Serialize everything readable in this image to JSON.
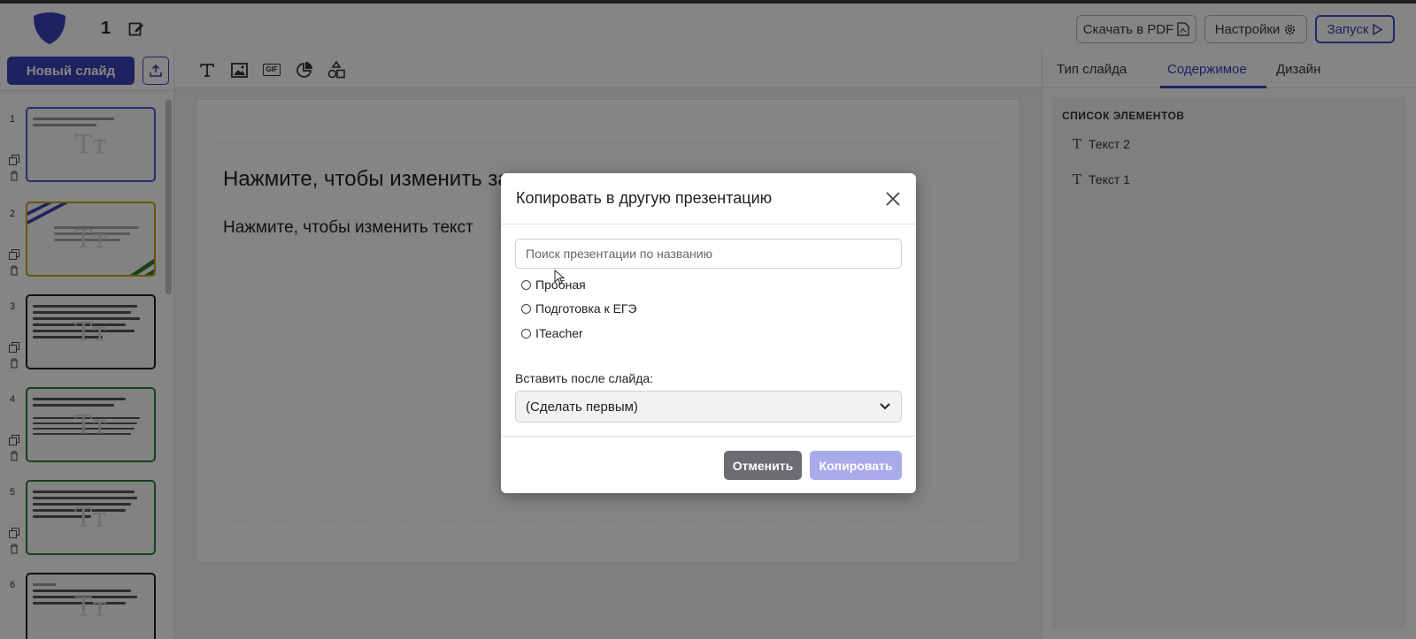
{
  "header": {
    "presentation_name": "1",
    "download_pdf_label": "Скачать в PDF",
    "settings_label": "Настройки",
    "start_label": "Запуск"
  },
  "sidebar": {
    "new_slide_label": "Новый слайд",
    "slides": [
      {
        "number": "1"
      },
      {
        "number": "2"
      },
      {
        "number": "3"
      },
      {
        "number": "4"
      },
      {
        "number": "5"
      },
      {
        "number": "6"
      }
    ]
  },
  "toolbar": {
    "gif_label": "GIF"
  },
  "slide": {
    "title": "Нажмите, чтобы изменить заголовок",
    "text": "Нажмите, чтобы изменить текст"
  },
  "right_panel": {
    "tabs": [
      "Тип слайда",
      "Содержимое",
      "Дизайн"
    ],
    "active_tab": "Содержимое",
    "elements_title": "СПИСОК ЭЛЕМЕНТОВ",
    "elements": [
      "Текст 2",
      "Текст 1"
    ]
  },
  "modal": {
    "title": "Копировать в другую презентацию",
    "search_placeholder": "Поиск презентации по названию",
    "presentations": [
      "Пробная",
      "Подготовка к ЕГЭ",
      "ITeacher"
    ],
    "insert_after_label": "Вставить после слайда:",
    "insert_after_value": "(Сделать первым)",
    "cancel_label": "Отменить",
    "copy_label": "Копировать"
  },
  "colors": {
    "accent": "#3d42b8",
    "copy_button": "#a8aaea",
    "cancel_button": "#6b6b70"
  }
}
